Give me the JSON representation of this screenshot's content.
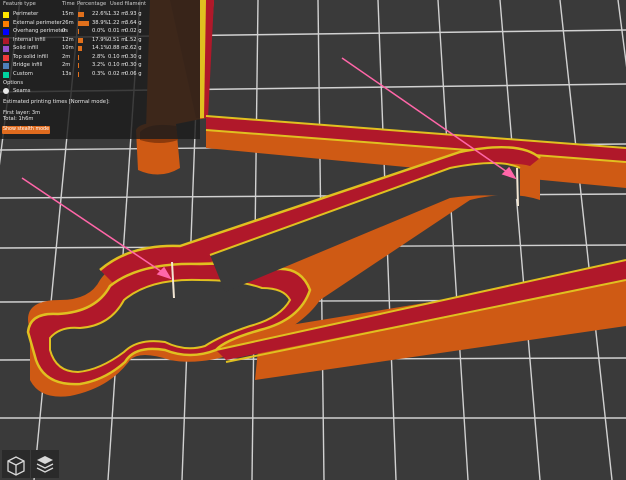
{
  "colors": {
    "background": "#3a3a3a",
    "grid": "#e2e2e2",
    "wall_orange": "#cf5a14",
    "wall_dark": "#8c3a0c",
    "infill_red": "#b0182a",
    "perimeter_yellow": "#e0c020",
    "arrow_pink": "#ff66a8",
    "accent": "#e06b1e"
  },
  "legend": {
    "headers": {
      "feature": "Feature type",
      "time": "Time",
      "percentage": "Percentage",
      "used": "Used filament"
    },
    "items": [
      {
        "name": "Perimeter",
        "time": "15m",
        "percent": "22.6%",
        "length": "1.32 m",
        "weight": "3.93 g",
        "color": "#ffe600"
      },
      {
        "name": "External perimeter",
        "time": "26m",
        "percent": "38.9%",
        "length": "1.22 m",
        "weight": "3.64 g",
        "color": "#ff7d00"
      },
      {
        "name": "Overhang perimeter",
        "time": "0s",
        "percent": "0.0%",
        "length": "0.01 m",
        "weight": "0.02 g",
        "color": "#0000ff"
      },
      {
        "name": "Internal infill",
        "time": "12m",
        "percent": "17.9%",
        "length": "0.51 m",
        "weight": "1.52 g",
        "color": "#b0182a"
      },
      {
        "name": "Solid infill",
        "time": "10m",
        "percent": "14.1%",
        "length": "0.88 m",
        "weight": "2.62 g",
        "color": "#9654cc"
      },
      {
        "name": "Top solid infill",
        "time": "2m",
        "percent": "2.8%",
        "length": "0.10 m",
        "weight": "0.30 g",
        "color": "#f03c3c"
      },
      {
        "name": "Bridge infill",
        "time": "2m",
        "percent": "3.2%",
        "length": "0.10 m",
        "weight": "0.30 g",
        "color": "#4d80ba"
      },
      {
        "name": "Custom",
        "time": "13s",
        "percent": "0.3%",
        "length": "0.02 m",
        "weight": "0.06 g",
        "color": "#00d3a0"
      }
    ],
    "options_title": "Options",
    "seams_label": "Seams",
    "estimated_title": "Estimated printing times [Normal mode]:",
    "first_layer": "First layer: 3m",
    "total": "Total:      1h6m",
    "stealth_button": "Show stealth mode"
  },
  "view_buttons": [
    {
      "name": "iso-view-icon"
    },
    {
      "name": "layers-view-icon"
    }
  ]
}
